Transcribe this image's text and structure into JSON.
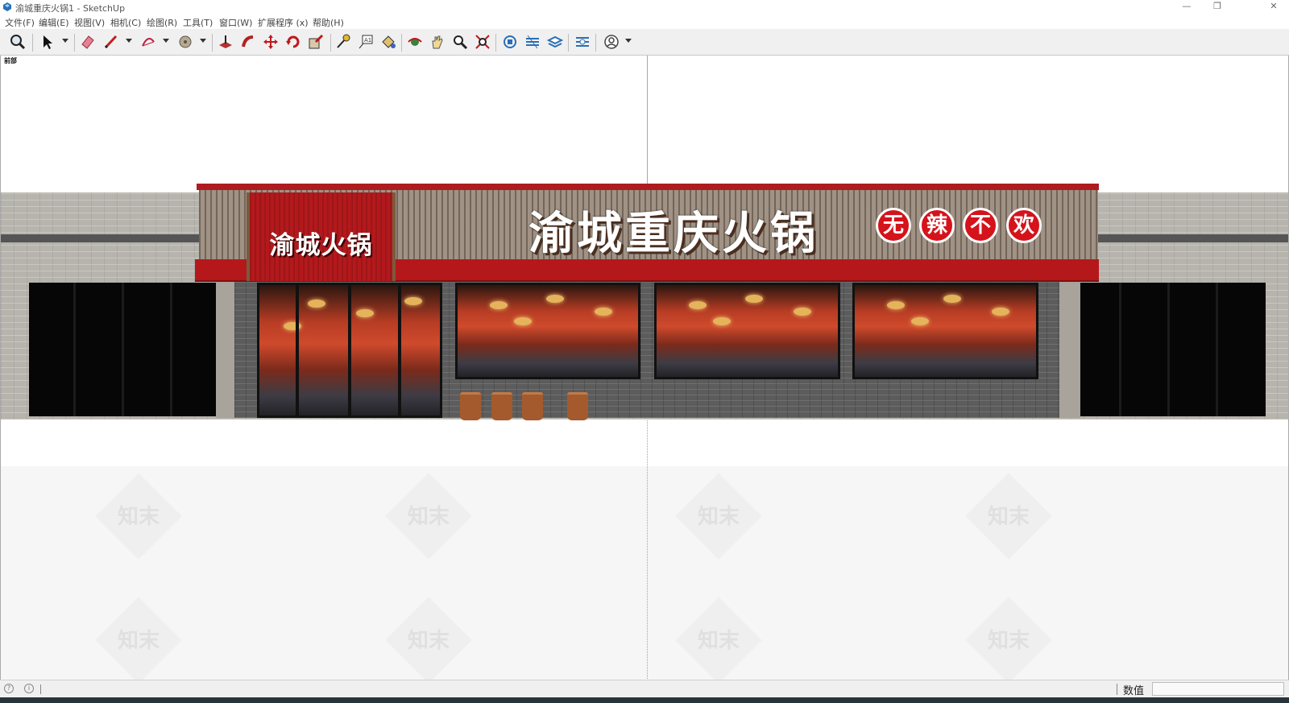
{
  "window": {
    "title": "渝城重庆火锅1 - SketchUp",
    "minimize_glyph": "—",
    "restore_glyph": "❐",
    "close_glyph": "✕"
  },
  "menu": {
    "items": [
      "文件(F)",
      "编辑(E)",
      "视图(V)",
      "相机(C)",
      "绘图(R)",
      "工具(T)",
      "窗口(W)",
      "扩展程序 (x)",
      "帮助(H)"
    ]
  },
  "toolbar": {
    "tools": [
      "zoom",
      "select",
      "eraser",
      "pencil-line",
      "arc",
      "shapes",
      "push-pull",
      "follow-me",
      "move",
      "rotate",
      "scale",
      "tape-measure",
      "text-label",
      "paint-bucket",
      "orbit",
      "pan",
      "zoom-window",
      "zoom-extents",
      "components",
      "styles",
      "layers",
      "scenes",
      "account"
    ]
  },
  "viewport": {
    "view_label": "前部",
    "watermark": "知末"
  },
  "storefront": {
    "main_sign": "渝城重庆火锅",
    "sub_sign": "渝城火锅",
    "slogan": [
      "无",
      "辣",
      "不",
      "欢"
    ]
  },
  "status": {
    "measurements_label": "数值",
    "measurements_value": ""
  },
  "colors": {
    "sign_red": "#b5181b",
    "slogan_red": "#d5131b",
    "toolbar_bg": "#f0f0f0"
  }
}
